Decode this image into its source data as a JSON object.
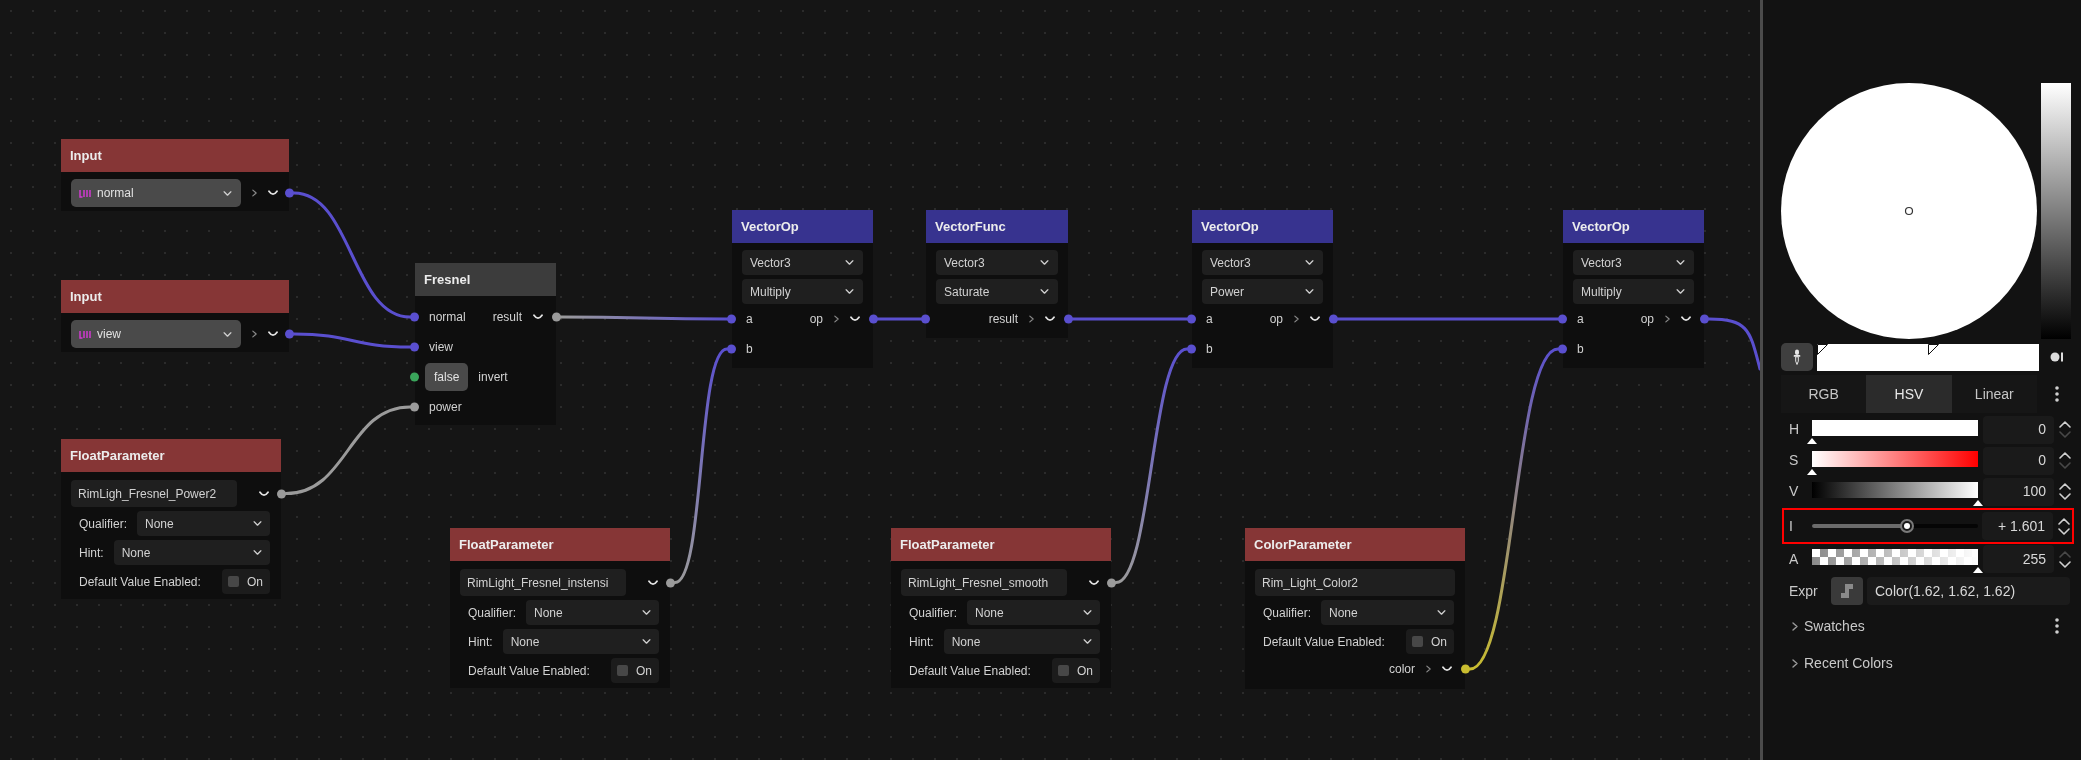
{
  "canvas": {
    "nodes": [
      {
        "kind": "input",
        "title": "Input",
        "color": "#863636",
        "rows": [
          {
            "kind": "variable",
            "value": "normal",
            "output": {
              "expandable": true,
              "color": "#5a4fcf"
            }
          }
        ]
      },
      {
        "kind": "input",
        "title": "Input",
        "color": "#863636",
        "rows": [
          {
            "kind": "variable",
            "value": "view",
            "output": {
              "expandable": true,
              "color": "#5a4fcf"
            }
          }
        ]
      },
      {
        "kind": "parameter",
        "title": "FloatParameter",
        "color": "#863636",
        "rows": [
          {
            "kind": "text",
            "value": "RimLigh_Fresnel_Power2",
            "output": {
              "expandable": false,
              "color": "#9b9b9b"
            }
          },
          {
            "kind": "labeled_select",
            "label": "Qualifier:",
            "value": "None"
          },
          {
            "kind": "labeled_select",
            "label": "Hint:",
            "value": "None"
          },
          {
            "kind": "checkbox",
            "label": "Default Value Enabled:",
            "text": "On",
            "checked": false
          }
        ]
      },
      {
        "kind": "function",
        "title": "Fresnel",
        "color": "#3c3c3c",
        "rows": [
          {
            "kind": "io",
            "input": {
              "label": "normal",
              "color": "#5a4fcf"
            },
            "output": {
              "label": "result",
              "expandable": false,
              "color": "#9b9b9b"
            }
          },
          {
            "kind": "io",
            "input": {
              "label": "view",
              "color": "#5a4fcf"
            }
          },
          {
            "kind": "bool",
            "input": {
              "color": "#3aa55b"
            },
            "value": "false",
            "label": "invert"
          },
          {
            "kind": "io",
            "input": {
              "label": "power",
              "color": "#9b9b9b"
            }
          }
        ]
      },
      {
        "kind": "parameter",
        "title": "FloatParameter",
        "color": "#863636",
        "rows": [
          {
            "kind": "text",
            "value": "RimLight_Fresnel_instensi",
            "output": {
              "expandable": false,
              "color": "#9b9b9b"
            }
          },
          {
            "kind": "labeled_select",
            "label": "Qualifier:",
            "value": "None"
          },
          {
            "kind": "labeled_select",
            "label": "Hint:",
            "value": "None"
          },
          {
            "kind": "checkbox",
            "label": "Default Value Enabled:",
            "text": "On",
            "checked": false
          }
        ]
      },
      {
        "kind": "operation",
        "title": "VectorOp",
        "color": "#37338f",
        "rows": [
          {
            "kind": "select",
            "value": "Vector3"
          },
          {
            "kind": "select",
            "value": "Multiply"
          },
          {
            "kind": "io",
            "input": {
              "label": "a",
              "color": "#5a4fcf"
            },
            "output": {
              "label": "op",
              "expandable": true,
              "color": "#5a4fcf"
            }
          },
          {
            "kind": "io",
            "input": {
              "label": "b",
              "color": "#5a4fcf"
            }
          }
        ]
      },
      {
        "kind": "operation",
        "title": "VectorFunc",
        "color": "#37338f",
        "rows": [
          {
            "kind": "select",
            "value": "Vector3"
          },
          {
            "kind": "select",
            "value": "Saturate"
          },
          {
            "kind": "io",
            "input": {
              "color": "#5a4fcf"
            },
            "output": {
              "label": "result",
              "expandable": true,
              "color": "#5a4fcf"
            }
          }
        ]
      },
      {
        "kind": "parameter",
        "title": "FloatParameter",
        "color": "#863636",
        "rows": [
          {
            "kind": "text",
            "value": "RimLight_Fresnel_smooth",
            "output": {
              "expandable": false,
              "color": "#9b9b9b"
            }
          },
          {
            "kind": "labeled_select",
            "label": "Qualifier:",
            "value": "None"
          },
          {
            "kind": "labeled_select",
            "label": "Hint:",
            "value": "None"
          },
          {
            "kind": "checkbox",
            "label": "Default Value Enabled:",
            "text": "On",
            "checked": false
          }
        ]
      },
      {
        "kind": "operation",
        "title": "VectorOp",
        "color": "#37338f",
        "rows": [
          {
            "kind": "select",
            "value": "Vector3"
          },
          {
            "kind": "select",
            "value": "Power"
          },
          {
            "kind": "io",
            "input": {
              "label": "a",
              "color": "#5a4fcf"
            },
            "output": {
              "label": "op",
              "expandable": true,
              "color": "#5a4fcf"
            }
          },
          {
            "kind": "io",
            "input": {
              "label": "b",
              "color": "#5a4fcf"
            }
          }
        ]
      },
      {
        "kind": "parameter",
        "title": "ColorParameter",
        "color": "#863636",
        "rows": [
          {
            "kind": "text",
            "value": "Rim_Light_Color2"
          },
          {
            "kind": "labeled_select",
            "label": "Qualifier:",
            "value": "None"
          },
          {
            "kind": "checkbox",
            "label": "Default Value Enabled:",
            "text": "On",
            "checked": false
          },
          {
            "kind": "io",
            "output": {
              "label": "color",
              "expandable": true,
              "color": "#c9bd30"
            }
          }
        ]
      },
      {
        "kind": "operation",
        "title": "VectorOp",
        "color": "#37338f",
        "rows": [
          {
            "kind": "select",
            "value": "Vector3"
          },
          {
            "kind": "select",
            "value": "Multiply"
          },
          {
            "kind": "io",
            "input": {
              "label": "a",
              "color": "#5a4fcf"
            },
            "output": {
              "label": "op",
              "expandable": true,
              "color": "#5a4fcf"
            }
          },
          {
            "kind": "io",
            "input": {
              "label": "b",
              "color": "#5a4fcf"
            }
          }
        ]
      }
    ]
  },
  "color_picker": {
    "tabs": [
      {
        "label": "RGB",
        "selected": false
      },
      {
        "label": "HSV",
        "selected": true
      },
      {
        "label": "Linear",
        "selected": false
      }
    ],
    "channels": [
      {
        "kind": "hue",
        "label": "H",
        "level": 0,
        "value": "0",
        "up_enabled": true,
        "down_enabled": false,
        "highlighted": false
      },
      {
        "kind": "saturation",
        "label": "S",
        "level": 0,
        "value": "0",
        "up_enabled": true,
        "down_enabled": false,
        "highlighted": false
      },
      {
        "kind": "value",
        "label": "V",
        "level": 1,
        "value": "100",
        "up_enabled": true,
        "down_enabled": true,
        "highlighted": false
      },
      {
        "kind": "intensity",
        "label": "I",
        "level": 0.57,
        "value": "+ 1.601",
        "up_enabled": true,
        "down_enabled": true,
        "highlighted": true
      },
      {
        "kind": "alpha",
        "label": "A",
        "level": 1,
        "value": "255",
        "up_enabled": false,
        "down_enabled": true,
        "highlighted": false
      }
    ],
    "expression": {
      "label": "Expr",
      "value": "Color(1.62, 1.62, 1.62)"
    },
    "sections": [
      {
        "label": "Swatches",
        "expanded": false,
        "menu": true
      },
      {
        "label": "Recent Colors",
        "expanded": false,
        "menu": false
      }
    ]
  }
}
